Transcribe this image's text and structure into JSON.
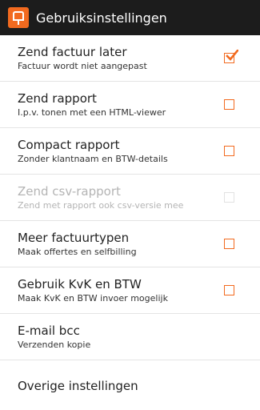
{
  "accent_color": "#f26a1f",
  "app_bar": {
    "title": "Gebruiksinstellingen",
    "logo_icon": "app-logo-icon"
  },
  "settings": [
    {
      "title": "Zend factuur later",
      "summary": "Factuur wordt niet aangepast",
      "checkbox": true,
      "checked": true,
      "enabled": true
    },
    {
      "title": "Zend rapport",
      "summary": "I.p.v. tonen met een HTML-viewer",
      "checkbox": true,
      "checked": false,
      "enabled": true
    },
    {
      "title": "Compact rapport",
      "summary": "Zonder klantnaam en BTW-details",
      "checkbox": true,
      "checked": false,
      "enabled": true
    },
    {
      "title": "Zend csv-rapport",
      "summary": "Zend met rapport ook csv-versie mee",
      "checkbox": true,
      "checked": false,
      "enabled": false
    },
    {
      "title": "Meer factuurtypen",
      "summary": "Maak offertes en selfbilling",
      "checkbox": true,
      "checked": false,
      "enabled": true
    },
    {
      "title": "Gebruik KvK en BTW",
      "summary": "Maak KvK en BTW invoer mogelijk",
      "checkbox": true,
      "checked": false,
      "enabled": true
    },
    {
      "title": "E-mail bcc",
      "summary": "Verzenden kopie",
      "checkbox": false
    },
    {
      "title": "Overige instellingen",
      "checkbox": false
    }
  ]
}
